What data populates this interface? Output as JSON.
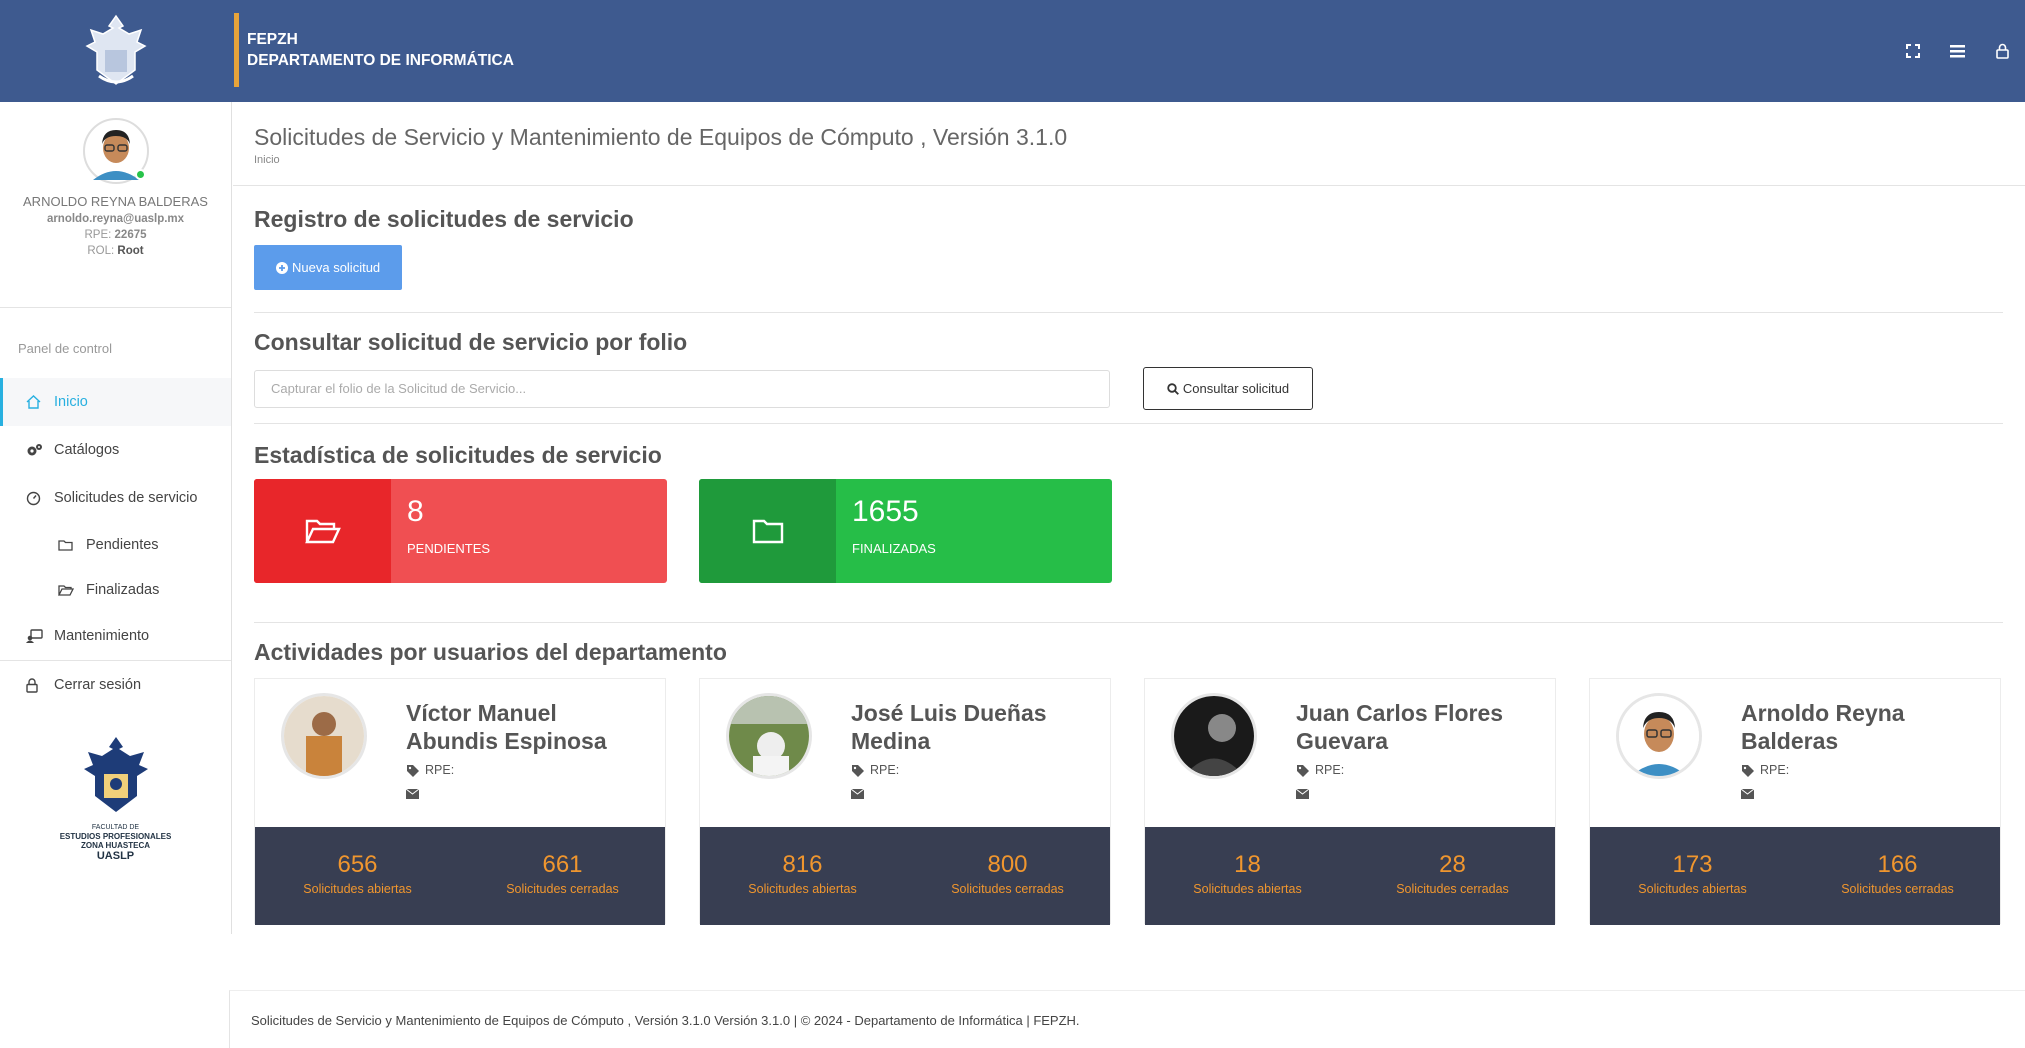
{
  "header": {
    "org": "FEPZH",
    "department": "DEPARTAMENTO DE INFORMÁTICA",
    "icons": [
      "expand-icon",
      "menu-icon",
      "lock-icon"
    ]
  },
  "sidebar": {
    "user": {
      "name": "ARNOLDO REYNA BALDERAS",
      "email": "arnoldo.reyna@uaslp.mx",
      "rpe_label": "RPE:",
      "rpe": "22675",
      "rol_label": "ROL:",
      "rol": "Root"
    },
    "panel_label": "Panel de control",
    "items": [
      {
        "label": "Inicio",
        "icon": "home-icon"
      },
      {
        "label": "Catálogos",
        "icon": "gears-icon"
      },
      {
        "label": "Solicitudes de servicio",
        "icon": "gauge-icon"
      },
      {
        "label": "Pendientes",
        "icon": "folder-icon"
      },
      {
        "label": "Finalizadas",
        "icon": "folder-open-icon"
      },
      {
        "label": "Mantenimiento",
        "icon": "maintenance-icon"
      },
      {
        "label": "Cerrar sesión",
        "icon": "lock-icon"
      }
    ],
    "faculty": {
      "line1": "FACULTAD DE",
      "line2": "ESTUDIOS PROFESIONALES",
      "line3": "ZONA HUASTECA",
      "line4": "UASLP"
    }
  },
  "page": {
    "title": "Solicitudes de Servicio y Mantenimiento de Equipos de Cómputo , Versión 3.1.0",
    "breadcrumb": "Inicio"
  },
  "registro": {
    "title": "Registro de solicitudes de servicio",
    "button": "Nueva solicitud"
  },
  "consulta": {
    "title": "Consultar solicitud de servicio por folio",
    "placeholder": "Capturar el folio de la Solicitud de Servicio...",
    "button": "Consultar solicitud"
  },
  "estadistica": {
    "title": "Estadística de solicitudes de servicio",
    "pendientes": {
      "value": "8",
      "label": "PENDIENTES",
      "color": "#f04f52",
      "icon_bg": "#e8262a"
    },
    "finalizadas": {
      "value": "1655",
      "label": "FINALIZADAS",
      "color": "#26be48",
      "icon_bg": "#1f9a3b"
    }
  },
  "actividades": {
    "title": "Actividades por usuarios del departamento",
    "rpe_label": "RPE:",
    "open_label": "Solicitudes abiertas",
    "closed_label": "Solicitudes cerradas",
    "users": [
      {
        "name1": "Víctor Manuel",
        "name2": "Abundis Espinosa",
        "open": "656",
        "closed": "661"
      },
      {
        "name1": "José Luis Dueñas",
        "name2": "Medina",
        "open": "816",
        "closed": "800"
      },
      {
        "name1": "Juan Carlos Flores",
        "name2": "Guevara",
        "open": "18",
        "closed": "28"
      },
      {
        "name1": "Arnoldo Reyna",
        "name2": "Balderas",
        "open": "173",
        "closed": "166"
      }
    ]
  },
  "footer": {
    "text": "Solicitudes de Servicio y Mantenimiento de Equipos de Cómputo , Versión 3.1.0 Versión 3.1.0 | © 2024 - Departamento de Informática | FEPZH."
  }
}
